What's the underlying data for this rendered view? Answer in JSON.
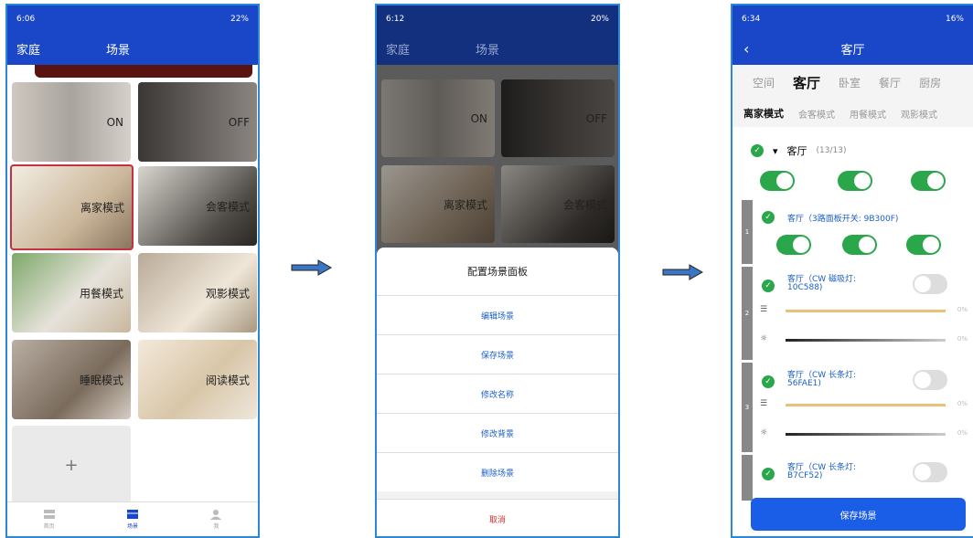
{
  "phone1": {
    "status": {
      "time": "6:06",
      "right": "22%"
    },
    "title_left": "家庭",
    "title_center": "场景",
    "tiles": [
      {
        "label": "ON"
      },
      {
        "label": "OFF"
      },
      {
        "label": "离家模式"
      },
      {
        "label": "会客模式"
      },
      {
        "label": "用餐模式"
      },
      {
        "label": "观影模式"
      },
      {
        "label": "睡眠模式"
      },
      {
        "label": "阅读模式"
      }
    ],
    "add": "+",
    "nav": [
      "首页",
      "场景",
      "我"
    ]
  },
  "phone2": {
    "status": {
      "time": "6:12",
      "right": "20%"
    },
    "title_left": "家庭",
    "title_center": "场景",
    "tiles": [
      "ON",
      "OFF",
      "离家模式",
      "会客模式"
    ],
    "sheet": {
      "title": "配置场景面板",
      "items": [
        "编辑场景",
        "保存场景",
        "修改名称",
        "修改背景",
        "删除场景"
      ],
      "cancel": "取消"
    }
  },
  "phone3": {
    "status": {
      "time": "6:34",
      "right": "16%"
    },
    "title": "客厅",
    "rooms": [
      "空间",
      "客厅",
      "卧室",
      "餐厅",
      "厨房"
    ],
    "modes": [
      "离家模式",
      "会客模式",
      "用餐模式",
      "观影模式"
    ],
    "group": {
      "name": "客厅",
      "count": "(13/13)"
    },
    "devices": [
      {
        "num": "1",
        "name": "客厅（3路面板开关: 9B300F)"
      },
      {
        "num": "2",
        "name": "客厅（CW 磁吸灯:",
        "sub": "10C588)",
        "p1": "0%",
        "p2": "0%"
      },
      {
        "num": "3",
        "name": "客厅（CW 长条灯:",
        "sub": "56FAE1)",
        "p1": "0%",
        "p2": "0%"
      },
      {
        "num": "",
        "name": "客厅（CW 长条灯:",
        "sub": "B7CF52)"
      }
    ],
    "save": "保存场景"
  },
  "colors": {
    "primary": "#1a47c8",
    "toggle_on": "#2aa64b",
    "accent": "#e8c27a",
    "arrow": "#3a76c4"
  }
}
